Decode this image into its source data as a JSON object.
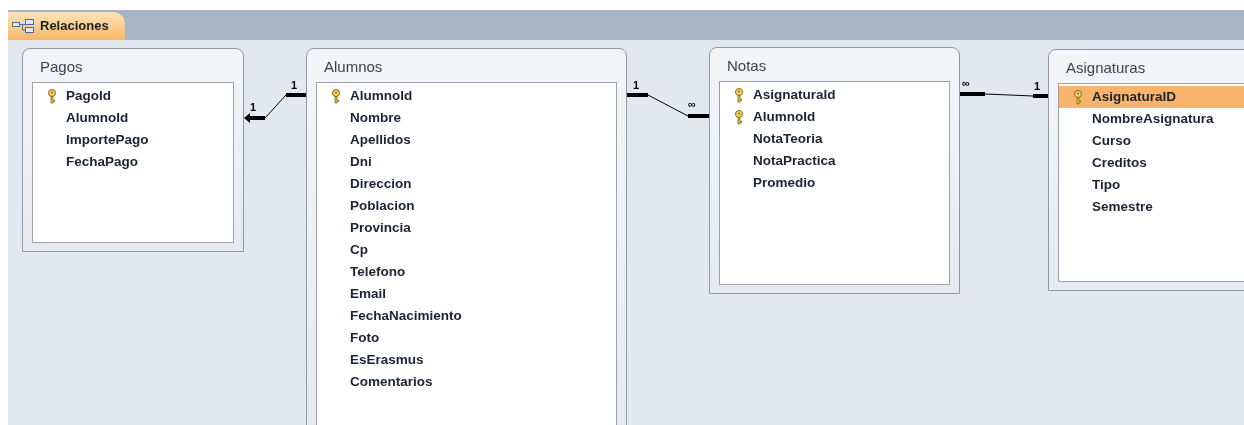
{
  "tab": {
    "label": "Relaciones",
    "selected": true
  },
  "tables": [
    {
      "name": "Pagos",
      "fields": [
        {
          "name": "PagoId",
          "primary_key": true,
          "selected": false
        },
        {
          "name": "AlumnoId",
          "primary_key": false,
          "selected": false
        },
        {
          "name": "ImportePago",
          "primary_key": false,
          "selected": false
        },
        {
          "name": "FechaPago",
          "primary_key": false,
          "selected": false
        }
      ]
    },
    {
      "name": "Alumnos",
      "fields": [
        {
          "name": "AlumnoId",
          "primary_key": true,
          "selected": false
        },
        {
          "name": "Nombre",
          "primary_key": false,
          "selected": false
        },
        {
          "name": "Apellidos",
          "primary_key": false,
          "selected": false
        },
        {
          "name": "Dni",
          "primary_key": false,
          "selected": false
        },
        {
          "name": "Direccion",
          "primary_key": false,
          "selected": false
        },
        {
          "name": "Poblacion",
          "primary_key": false,
          "selected": false
        },
        {
          "name": "Provincia",
          "primary_key": false,
          "selected": false
        },
        {
          "name": "Cp",
          "primary_key": false,
          "selected": false
        },
        {
          "name": "Telefono",
          "primary_key": false,
          "selected": false
        },
        {
          "name": "Email",
          "primary_key": false,
          "selected": false
        },
        {
          "name": "FechaNacimiento",
          "primary_key": false,
          "selected": false
        },
        {
          "name": "Foto",
          "primary_key": false,
          "selected": false
        },
        {
          "name": "EsErasmus",
          "primary_key": false,
          "selected": false
        },
        {
          "name": "Comentarios",
          "primary_key": false,
          "selected": false
        }
      ]
    },
    {
      "name": "Notas",
      "fields": [
        {
          "name": "AsignaturaId",
          "primary_key": true,
          "selected": false
        },
        {
          "name": "AlumnoId",
          "primary_key": true,
          "selected": false
        },
        {
          "name": "NotaTeoria",
          "primary_key": false,
          "selected": false
        },
        {
          "name": "NotaPractica",
          "primary_key": false,
          "selected": false
        },
        {
          "name": "Promedio",
          "primary_key": false,
          "selected": false
        }
      ]
    },
    {
      "name": "Asignaturas",
      "fields": [
        {
          "name": "AsignaturaID",
          "primary_key": true,
          "selected": true
        },
        {
          "name": "NombreAsignatura",
          "primary_key": false,
          "selected": false
        },
        {
          "name": "Curso",
          "primary_key": false,
          "selected": false
        },
        {
          "name": "Creditos",
          "primary_key": false,
          "selected": false
        },
        {
          "name": "Tipo",
          "primary_key": false,
          "selected": false
        },
        {
          "name": "Semestre",
          "primary_key": false,
          "selected": false
        }
      ]
    }
  ],
  "relationships": [
    {
      "left_label": "1",
      "right_label": "1"
    },
    {
      "left_label": "1",
      "right_label": "∞"
    },
    {
      "left_label": "∞",
      "right_label": "1"
    }
  ]
}
